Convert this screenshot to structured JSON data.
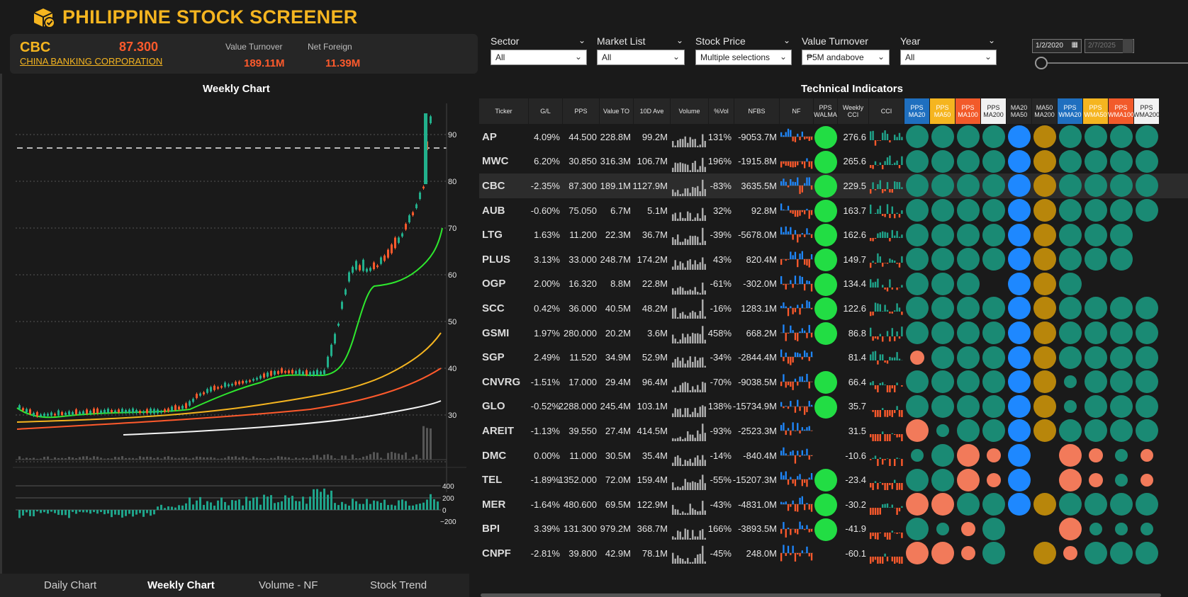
{
  "app": {
    "title": "PHILIPPINE STOCK SCREENER",
    "logo_icon": "box-check-icon"
  },
  "stock": {
    "code": "CBC",
    "price": "87.300",
    "company": "CHINA BANKING CORPORATION",
    "value_turnover_label": "Value Turnover",
    "value_turnover": "189.11M",
    "net_foreign_label": "Net Foreign",
    "net_foreign": "11.39M"
  },
  "filters": [
    {
      "label": "Sector",
      "value": "All"
    },
    {
      "label": "Market List",
      "value": "All"
    },
    {
      "label": "Stock Price",
      "value": "Multiple selections"
    },
    {
      "label": "Value Turnover",
      "value": "₱5M andabove"
    },
    {
      "label": "Year",
      "value": "All"
    }
  ],
  "date_range": {
    "start": "1/2/2020",
    "end": "2/7/2025"
  },
  "weekly_chart": {
    "title": "Weekly Chart",
    "price_ticks": [
      "90",
      "80",
      "70",
      "60",
      "50",
      "40",
      "30"
    ],
    "volume_ticks": [
      "400",
      "200",
      "0",
      "−200"
    ]
  },
  "tabs": [
    {
      "label": "Daily Chart",
      "active": false
    },
    {
      "label": "Weekly Chart",
      "active": true
    },
    {
      "label": "Volume - NF",
      "active": false
    },
    {
      "label": "Stock Trend",
      "active": false
    }
  ],
  "technical": {
    "title": "Technical Indicators",
    "headers": [
      "Ticker",
      "G/L",
      "PPS",
      "Value TO",
      "10D Ave",
      "Volume",
      "%Vol",
      "NFBS",
      "NF",
      "PPS WALMA",
      "Weekly CCI",
      "CCI",
      "PPS MA20",
      "PPS MA50",
      "PPS MA100",
      "PPS MA200",
      "MA20 MA50",
      "MA50 MA200",
      "PPS WMA20",
      "PPS WMA50",
      "PPS WMA100",
      "PPS WMA200"
    ],
    "header_colors": {
      "PPS MA20": "#1f6fbf",
      "PPS MA50": "#f5b520",
      "PPS MA100": "#f25a2a",
      "PPS MA200": "#f2f2f2",
      "PPS WMA20": "#1f6fbf",
      "PPS WMA50": "#f5b520",
      "PPS WMA100": "#f25a2a",
      "PPS WMA200": "#f2f2f2"
    },
    "dot_colors": {
      "teal": "#1a8a74",
      "blue": "#1e88ff",
      "gold": "#b8860b",
      "orange": "#f27a5a",
      "green": "#22dd44"
    },
    "rows": [
      {
        "ticker": "AP",
        "gl": "4.09%",
        "pps": "44.500",
        "vto": "228.8M",
        "ave": "99.2M",
        "pvol": "131%",
        "nfbs": "-9053.7M",
        "walma": true,
        "cci": "276.6"
      },
      {
        "ticker": "MWC",
        "gl": "6.20%",
        "pps": "30.850",
        "vto": "316.3M",
        "ave": "106.7M",
        "pvol": "196%",
        "nfbs": "-1915.8M",
        "walma": true,
        "cci": "265.6"
      },
      {
        "ticker": "CBC",
        "gl": "-2.35%",
        "pps": "87.300",
        "vto": "189.1M",
        "ave": "1127.9M",
        "pvol": "-83%",
        "nfbs": "3635.5M",
        "walma": true,
        "cci": "229.5"
      },
      {
        "ticker": "AUB",
        "gl": "-0.60%",
        "pps": "75.050",
        "vto": "6.7M",
        "ave": "5.1M",
        "pvol": "32%",
        "nfbs": "92.8M",
        "walma": true,
        "cci": "163.7"
      },
      {
        "ticker": "LTG",
        "gl": "1.63%",
        "pps": "11.200",
        "vto": "22.3M",
        "ave": "36.7M",
        "pvol": "-39%",
        "nfbs": "-5678.0M",
        "walma": true,
        "cci": "162.6"
      },
      {
        "ticker": "PLUS",
        "gl": "3.13%",
        "pps": "33.000",
        "vto": "248.7M",
        "ave": "174.2M",
        "pvol": "43%",
        "nfbs": "820.4M",
        "walma": true,
        "cci": "149.7"
      },
      {
        "ticker": "OGP",
        "gl": "2.00%",
        "pps": "16.320",
        "vto": "8.8M",
        "ave": "22.8M",
        "pvol": "-61%",
        "nfbs": "-302.0M",
        "walma": true,
        "cci": "134.4"
      },
      {
        "ticker": "SCC",
        "gl": "0.42%",
        "pps": "36.000",
        "vto": "40.5M",
        "ave": "48.2M",
        "pvol": "-16%",
        "nfbs": "1283.1M",
        "walma": true,
        "cci": "122.6"
      },
      {
        "ticker": "GSMI",
        "gl": "1.97%",
        "pps": "280.000",
        "vto": "20.2M",
        "ave": "3.6M",
        "pvol": "458%",
        "nfbs": "668.2M",
        "walma": true,
        "cci": "86.8"
      },
      {
        "ticker": "SGP",
        "gl": "2.49%",
        "pps": "11.520",
        "vto": "34.9M",
        "ave": "52.9M",
        "pvol": "-34%",
        "nfbs": "-2844.4M",
        "walma": false,
        "cci": "81.4"
      },
      {
        "ticker": "CNVRG",
        "gl": "-1.51%",
        "pps": "17.000",
        "vto": "29.4M",
        "ave": "96.4M",
        "pvol": "-70%",
        "nfbs": "-9038.5M",
        "walma": true,
        "cci": "66.4"
      },
      {
        "ticker": "GLO",
        "gl": "-0.52%",
        "pps": "2288.000",
        "vto": "245.4M",
        "ave": "103.1M",
        "pvol": "138%",
        "nfbs": "-15734.9M",
        "walma": true,
        "cci": "35.7"
      },
      {
        "ticker": "AREIT",
        "gl": "-1.13%",
        "pps": "39.550",
        "vto": "27.4M",
        "ave": "414.5M",
        "pvol": "-93%",
        "nfbs": "-2523.3M",
        "walma": false,
        "cci": "31.5"
      },
      {
        "ticker": "DMC",
        "gl": "0.00%",
        "pps": "11.000",
        "vto": "30.5M",
        "ave": "35.4M",
        "pvol": "-14%",
        "nfbs": "-840.4M",
        "walma": false,
        "cci": "-10.6"
      },
      {
        "ticker": "TEL",
        "gl": "-1.89%",
        "pps": "1352.000",
        "vto": "72.0M",
        "ave": "159.4M",
        "pvol": "-55%",
        "nfbs": "-15207.3M",
        "walma": true,
        "cci": "-23.4"
      },
      {
        "ticker": "MER",
        "gl": "-1.64%",
        "pps": "480.600",
        "vto": "69.5M",
        "ave": "122.9M",
        "pvol": "-43%",
        "nfbs": "-4831.0M",
        "walma": true,
        "cci": "-30.2"
      },
      {
        "ticker": "BPI",
        "gl": "3.39%",
        "pps": "131.300",
        "vto": "979.2M",
        "ave": "368.7M",
        "pvol": "166%",
        "nfbs": "-3893.5M",
        "walma": true,
        "cci": "-41.9"
      },
      {
        "ticker": "CNPF",
        "gl": "-2.81%",
        "pps": "39.800",
        "vto": "42.9M",
        "ave": "78.1M",
        "pvol": "-45%",
        "nfbs": "248.0M",
        "walma": false,
        "cci": "-60.1"
      }
    ]
  }
}
